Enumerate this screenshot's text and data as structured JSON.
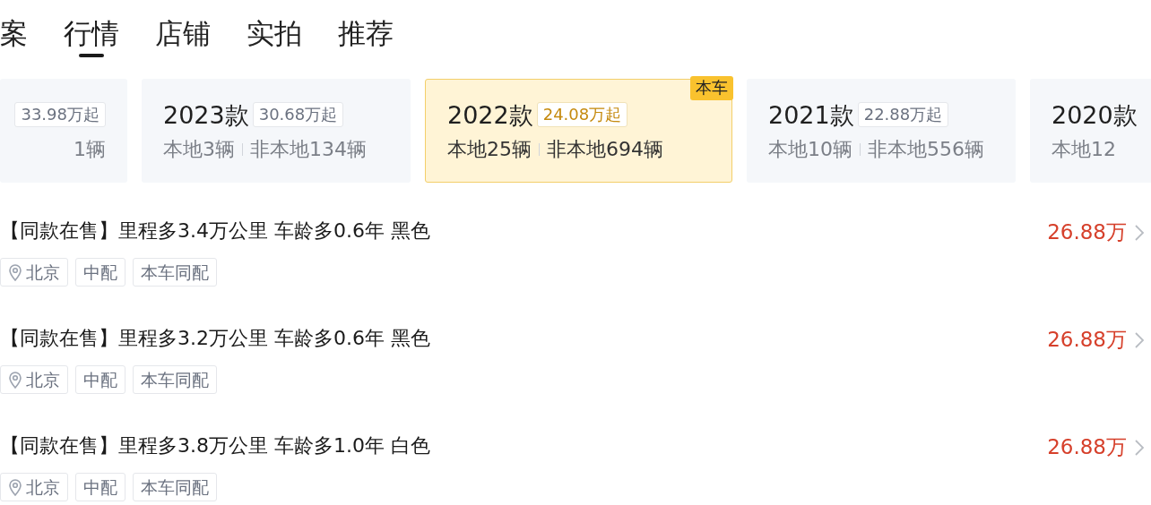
{
  "tabs": [
    {
      "label": "案",
      "selected": false
    },
    {
      "label": "行情",
      "selected": true
    },
    {
      "label": "店铺",
      "selected": false
    },
    {
      "label": "实拍",
      "selected": false
    },
    {
      "label": "推荐",
      "selected": false
    }
  ],
  "model_years": [
    {
      "price": "33.98万起",
      "local": "1辆",
      "selected": false
    },
    {
      "year": "2023款",
      "price": "30.68万起",
      "local": "本地3辆",
      "nonlocal": "非本地134辆",
      "selected": false
    },
    {
      "year": "2022款",
      "price": "24.08万起",
      "local": "本地25辆",
      "nonlocal": "非本地694辆",
      "selected": true,
      "badge": "本车"
    },
    {
      "year": "2021款",
      "price": "22.88万起",
      "local": "本地10辆",
      "nonlocal": "非本地556辆",
      "selected": false
    },
    {
      "year": "2020款",
      "local": "本地12",
      "selected": false
    }
  ],
  "listings": [
    {
      "title": "【同款在售】里程多3.4万公里 车龄多0.6年 黑色",
      "price": "26.88万",
      "tags": [
        {
          "kind": "location",
          "label": "北京"
        },
        {
          "kind": "plain",
          "label": "中配"
        },
        {
          "kind": "plain",
          "label": "本车同配"
        }
      ]
    },
    {
      "title": "【同款在售】里程多3.2万公里 车龄多0.6年 黑色",
      "price": "26.88万",
      "tags": [
        {
          "kind": "location",
          "label": "北京"
        },
        {
          "kind": "plain",
          "label": "中配"
        },
        {
          "kind": "plain",
          "label": "本车同配"
        }
      ]
    },
    {
      "title": "【同款在售】里程多3.8万公里 车龄多1.0年 白色",
      "price": "26.88万",
      "tags": [
        {
          "kind": "location",
          "label": "北京"
        },
        {
          "kind": "plain",
          "label": "中配"
        },
        {
          "kind": "plain",
          "label": "本车同配"
        }
      ]
    }
  ]
}
